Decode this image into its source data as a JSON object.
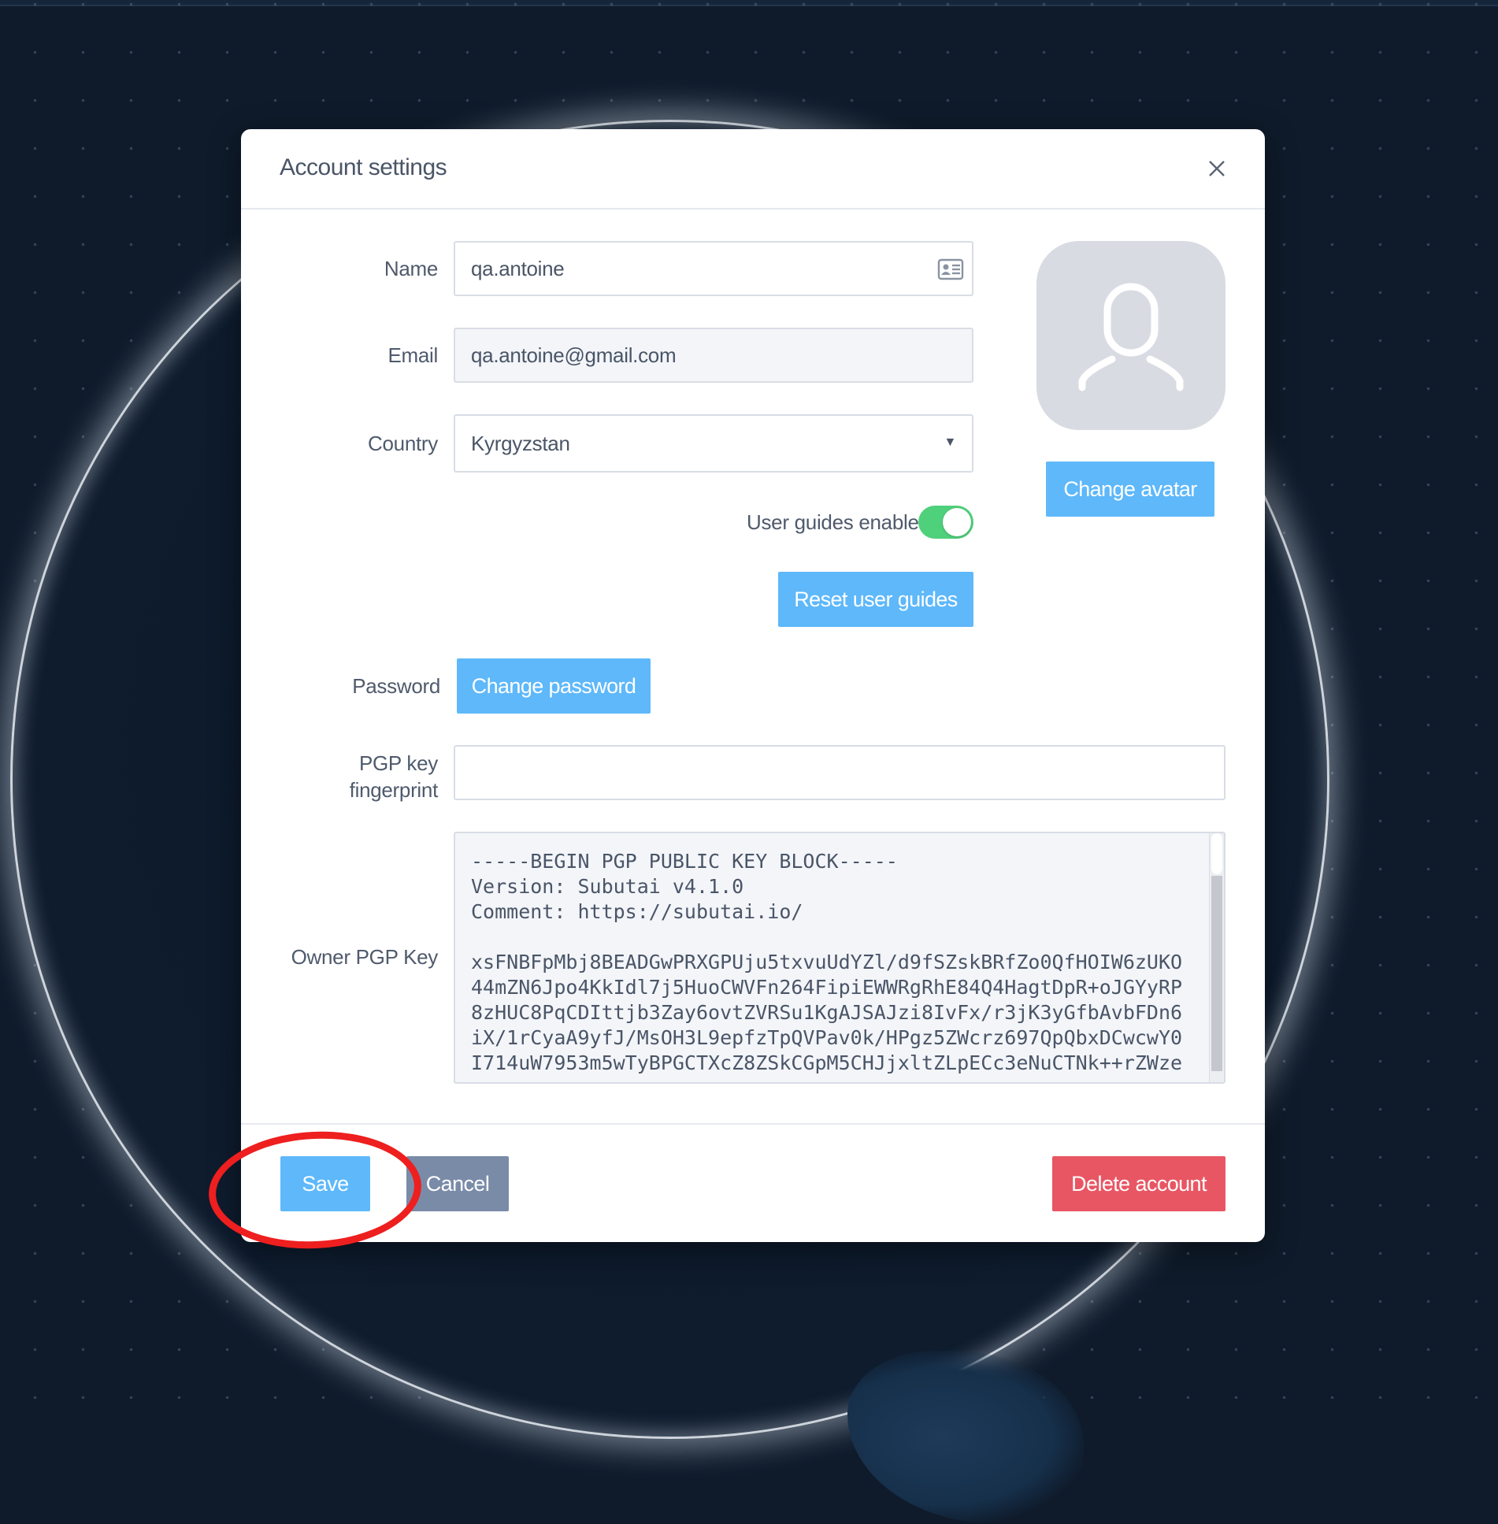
{
  "modal": {
    "title": "Account settings",
    "close_icon": "close-icon"
  },
  "form": {
    "name": {
      "label": "Name",
      "value": "qa.antoine",
      "icon": "contact-card-icon"
    },
    "email": {
      "label": "Email",
      "value": "qa.antoine@gmail.com"
    },
    "country": {
      "label": "Country",
      "value": "Kyrgyzstan",
      "arrow": "▼"
    },
    "user_guides": {
      "label": "User guides enabled",
      "enabled": true
    },
    "reset_guides_label": "Reset user guides",
    "password": {
      "label": "Password",
      "button_label": "Change password"
    },
    "pgp_fingerprint": {
      "label_line1": "PGP key",
      "label_line2": "fingerprint",
      "value": ""
    },
    "owner_pgp": {
      "label": "Owner PGP Key",
      "value": "-----BEGIN PGP PUBLIC KEY BLOCK-----\nVersion: Subutai v4.1.0\nComment: https://subutai.io/\n\nxsFNBFpMbj8BEADGwPRXGPUju5txvuUdYZl/d9fSZskBRfZo0QfHOIW6zUKO\n44mZN6Jpo4KkIdl7j5HuoCWVFn264FipiEWWRgRhE84Q4HagtDpR+oJGYyRP\n8zHUC8PqCDIttjb3Zay6ovtZVRSu1KgAJSAJzi8IvFx/r3jK3yGfbAvbFDn6\niX/1rCyaA9yfJ/MsOH3L9epfzTpQVPav0k/HPgz5ZWcrz697QpQbxDCwcwY0\nI714uW7953m5wTyBPGCTXcZ8ZSkCGpM5CHJjxltZLpECc3eNuCTNk++rZWze"
    }
  },
  "avatar": {
    "icon": "user-avatar-icon",
    "button_label": "Change avatar"
  },
  "footer": {
    "save_label": "Save",
    "cancel_label": "Cancel",
    "delete_label": "Delete account"
  },
  "colors": {
    "primary": "#5eb8fa",
    "secondary": "#7a8ba8",
    "danger": "#e85663",
    "toggle_on": "#4fd07b",
    "highlight": "#ee1f1f"
  }
}
